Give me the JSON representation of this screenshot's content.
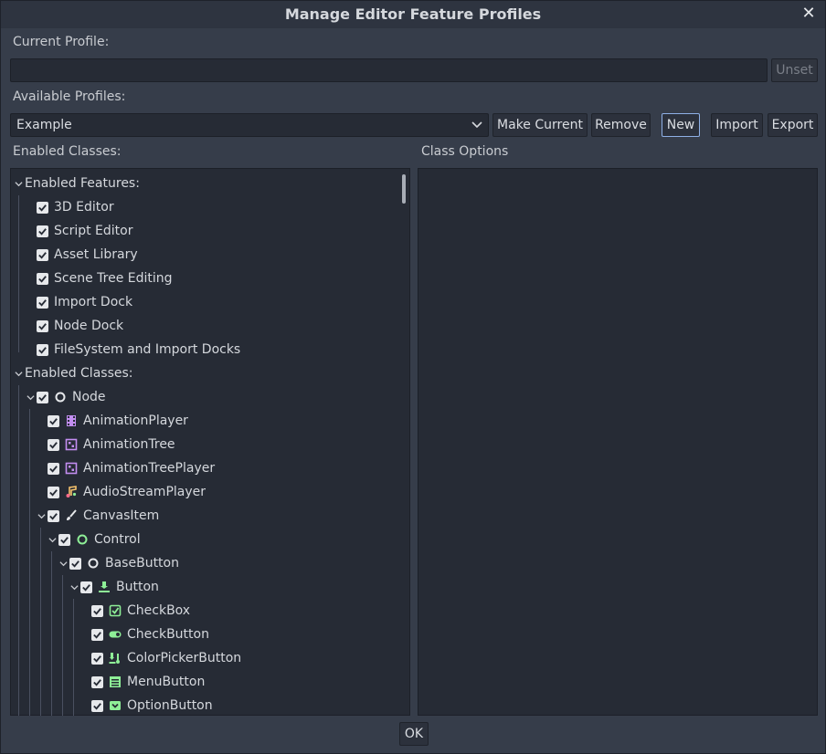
{
  "window": {
    "title": "Manage Editor Feature Profiles"
  },
  "current_profile": {
    "label": "Current Profile:",
    "value": "",
    "unset_label": "Unset"
  },
  "available_profiles": {
    "label": "Available Profiles:",
    "selected": "Example",
    "buttons": {
      "make_current": "Make Current",
      "remove": "Remove",
      "new": "New",
      "import": "Import",
      "export": "Export"
    }
  },
  "enabled_classes_label": "Enabled Classes:",
  "class_options_label": "Class Options",
  "tree": {
    "features_header": "Enabled Features:",
    "features": [
      "3D Editor",
      "Script Editor",
      "Asset Library",
      "Scene Tree Editing",
      "Import Dock",
      "Node Dock",
      "FileSystem and Import Docks"
    ],
    "classes_header": "Enabled Classes:",
    "node": "Node",
    "animation_player": "AnimationPlayer",
    "animation_tree": "AnimationTree",
    "animation_tree_player": "AnimationTreePlayer",
    "audio_stream_player": "AudioStreamPlayer",
    "canvas_item": "CanvasItem",
    "control": "Control",
    "base_button": "BaseButton",
    "button": "Button",
    "check_box": "CheckBox",
    "check_button": "CheckButton",
    "color_picker_button": "ColorPickerButton",
    "menu_button": "MenuButton",
    "option_button": "OptionButton"
  },
  "ok_label": "OK",
  "colors": {
    "accent_green": "#8eef97",
    "accent_purple": "#c38ef1",
    "focus_border": "#8fb0e6"
  }
}
